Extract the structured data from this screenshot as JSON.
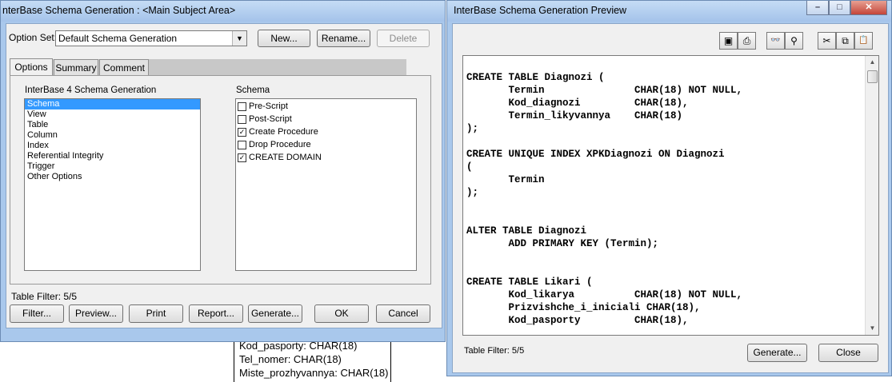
{
  "background_entity": {
    "lines": [
      "Kod_pasporty: CHAR(18)",
      "Tel_nomer: CHAR(18)",
      "Miste_prozhyvannya: CHAR(18)"
    ]
  },
  "left_dialog": {
    "title": "nterBase Schema Generation : <Main Subject Area>",
    "option_set_label": "Option Set:",
    "option_set_value": "Default Schema Generation",
    "buttons_top": {
      "new": "New...",
      "rename": "Rename...",
      "delete": "Delete"
    },
    "tabs": [
      {
        "label": "Options",
        "active": true
      },
      {
        "label": "Summary",
        "active": false
      },
      {
        "label": "Comment",
        "active": false
      }
    ],
    "categories_heading": "InterBase 4 Schema Generation",
    "categories": [
      {
        "label": "Schema",
        "selected": true
      },
      {
        "label": "View",
        "selected": false
      },
      {
        "label": "Table",
        "selected": false
      },
      {
        "label": "Column",
        "selected": false
      },
      {
        "label": "Index",
        "selected": false
      },
      {
        "label": "Referential Integrity",
        "selected": false
      },
      {
        "label": "Trigger",
        "selected": false
      },
      {
        "label": "Other Options",
        "selected": false
      }
    ],
    "schema_heading": "Schema",
    "schema_options": [
      {
        "label": "Pre-Script",
        "checked": false
      },
      {
        "label": "Post-Script",
        "checked": false
      },
      {
        "label": "Create Procedure",
        "checked": true
      },
      {
        "label": "Drop Procedure",
        "checked": false
      },
      {
        "label": "CREATE DOMAIN",
        "checked": true
      }
    ],
    "table_filter": "Table Filter: 5/5",
    "buttons_bottom": {
      "filter": "Filter...",
      "preview": "Preview...",
      "print": "Print",
      "report": "Report...",
      "generate": "Generate...",
      "ok": "OK",
      "cancel": "Cancel"
    }
  },
  "right_dialog": {
    "title": "InterBase Schema Generation Preview",
    "window_controls": {
      "minimize": "–",
      "maximize": "□",
      "close": "✕"
    },
    "toolbar_icons": [
      "save-icon",
      "print-icon",
      "find-icon",
      "find-next-icon",
      "cut-icon",
      "copy-icon",
      "paste-icon"
    ],
    "toolbar_glyphs": {
      "save": "▣",
      "print": "⎙",
      "find": "👓",
      "find_next": "⚲",
      "cut": "✂",
      "copy": "⧉",
      "paste": "📋"
    },
    "code": "CREATE TABLE Diagnozi (\n       Termin               CHAR(18) NOT NULL,\n       Kod_diagnozi         CHAR(18),\n       Termin_likyvannya    CHAR(18)\n);\n\nCREATE UNIQUE INDEX XPKDiagnozi ON Diagnozi\n(\n       Termin\n);\n\n\nALTER TABLE Diagnozi\n       ADD PRIMARY KEY (Termin);\n\n\nCREATE TABLE Likari (\n       Kod_likarya          CHAR(18) NOT NULL,\n       Prizvishche_i_iniciali CHAR(18),\n       Kod_pasporty         CHAR(18),",
    "table_filter": "Table Filter: 5/5",
    "buttons": {
      "generate": "Generate...",
      "close": "Close"
    },
    "scroll_arrows": {
      "up": "▲",
      "down": "▼"
    }
  }
}
